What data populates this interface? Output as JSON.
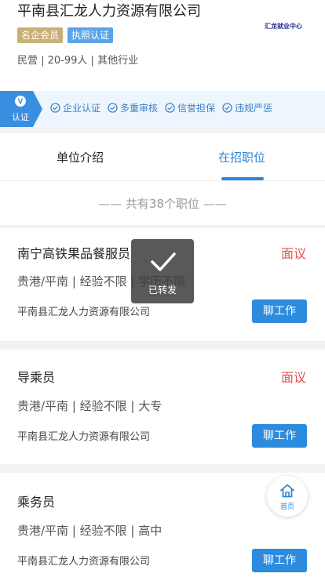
{
  "company": {
    "name": "平南县汇龙人力资源有限公司",
    "logo_text": "汇龙就业中心",
    "badges": [
      "名企会员",
      "执照认证"
    ],
    "meta": "民营 | 20-99人 | 其他行业"
  },
  "cert": {
    "flag_label": "认证",
    "flag_letter": "V",
    "items": [
      "企业认证",
      "多重审核",
      "信誉担保",
      "违规严惩"
    ]
  },
  "tabs": {
    "intro": "单位介绍",
    "jobs": "在招职位"
  },
  "total": "—— 共有38个职位 ——",
  "jobs": [
    {
      "title": "南宁高铁果品餐服员",
      "salary": "面议",
      "requirements": "贵港/平南 | 经验不限 | 学历不限",
      "company": "平南县汇龙人力资源有限公司",
      "action": "聊工作"
    },
    {
      "title": "导乘员",
      "salary": "面议",
      "requirements": "贵港/平南 | 经验不限 | 大专",
      "company": "平南县汇龙人力资源有限公司",
      "action": "聊工作"
    },
    {
      "title": "乘务员",
      "salary": "",
      "requirements": "贵港/平南 | 经验不限 | 高中",
      "company": "平南县汇龙人力资源有限公司",
      "action": "聊工作"
    }
  ],
  "toast": {
    "text": "已转发",
    "icon": "check-icon"
  },
  "home_button": {
    "label": "首页",
    "icon": "home-icon"
  },
  "colors": {
    "accent": "#2f87d6",
    "salary": "#e5534b",
    "gold_badge": "#c9b077",
    "blue_badge": "#5aa4e8"
  }
}
